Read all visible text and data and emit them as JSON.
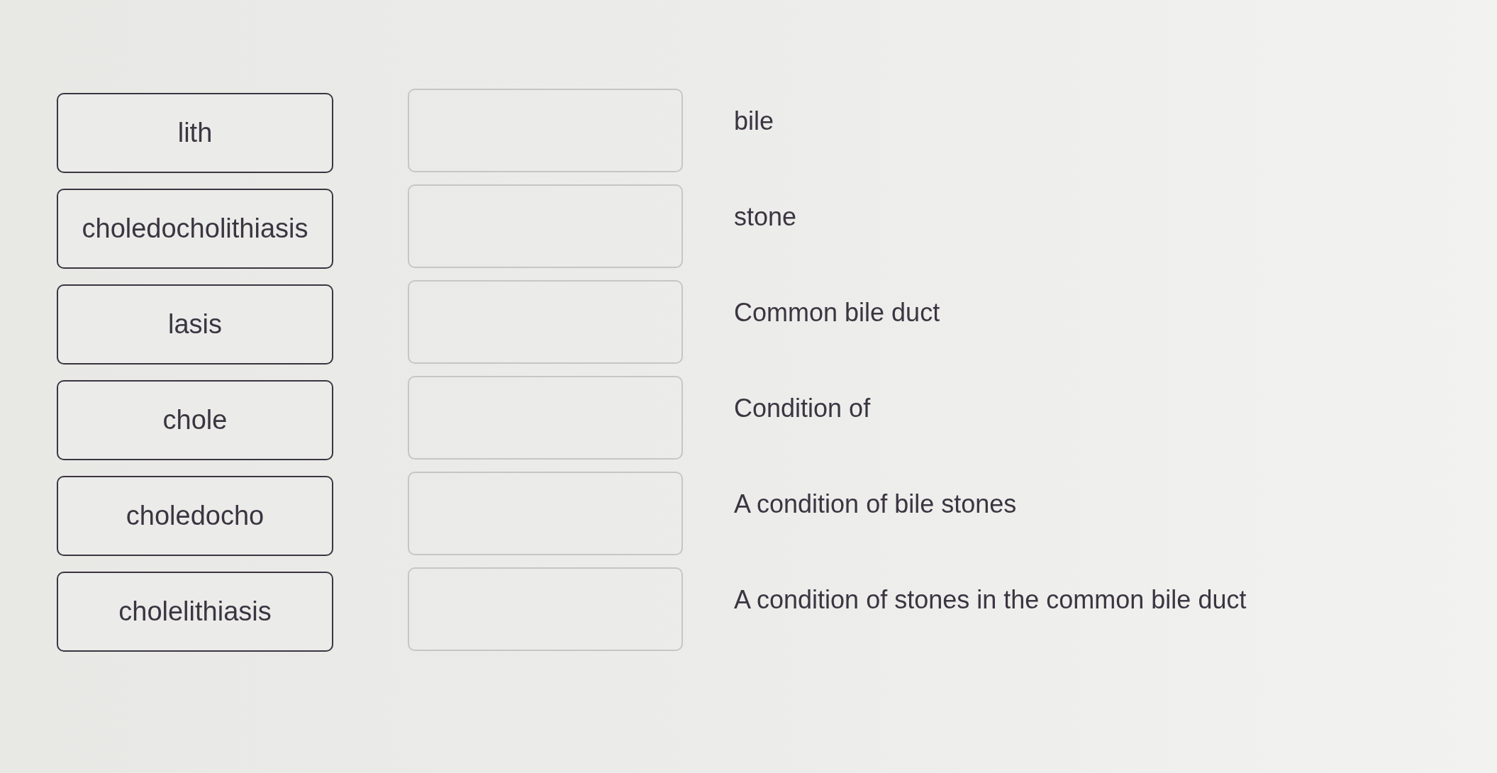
{
  "terms": [
    {
      "text": "lith"
    },
    {
      "text": "choledocholithiasis"
    },
    {
      "text": "lasis"
    },
    {
      "text": "chole"
    },
    {
      "text": "choledocho"
    },
    {
      "text": "cholelithiasis"
    }
  ],
  "definitions": [
    {
      "text": "bile"
    },
    {
      "text": "stone"
    },
    {
      "text": "Common bile duct"
    },
    {
      "text": "Condition of"
    },
    {
      "text": "A condition of bile stones"
    },
    {
      "text": "A condition of stones in the common bile duct"
    }
  ]
}
